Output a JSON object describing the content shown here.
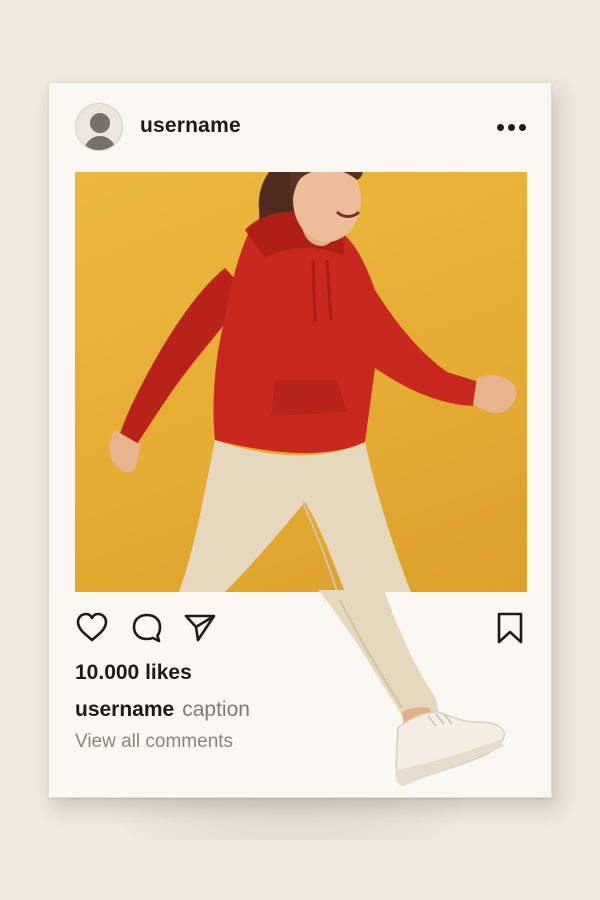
{
  "post": {
    "username": "username",
    "likes": "10.000 likes",
    "caption_username": "username",
    "caption": "caption",
    "view_comments": "View all comments"
  },
  "icons": {
    "avatar": "user-avatar-icon",
    "more": "more-options-icon",
    "like": "heart-icon",
    "comment": "comment-bubble-icon",
    "share": "send-paper-plane-icon",
    "save": "bookmark-icon"
  },
  "colors": {
    "photo_background": "#e8ae35",
    "hoodie": "#c9281f",
    "pants": "#e6d8bd",
    "wall": "#efe8dc",
    "card": "#fbf8f3",
    "text": "#1d1a17",
    "muted": "#7e7a74"
  }
}
